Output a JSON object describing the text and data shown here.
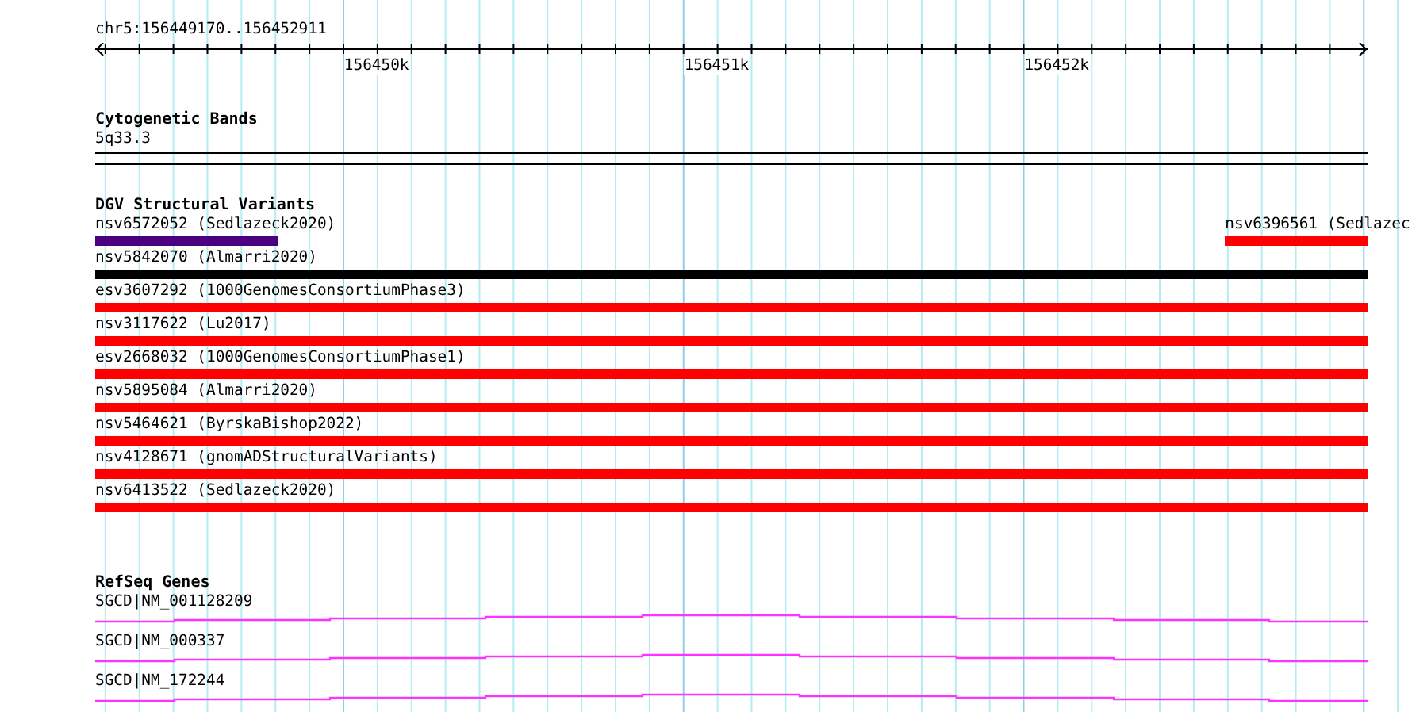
{
  "ruler": {
    "title": "chr5:156449170..156452911",
    "tick_labels": [
      "156450k",
      "156451k",
      "156452k"
    ]
  },
  "tracks": [
    {
      "kind": "band",
      "title": "Cytogenetic Bands",
      "label": "5q33.3"
    },
    {
      "kind": "variants",
      "title": "DGV Structural Variants",
      "rows": [
        [
          {
            "label": "nsv6572052 (Sedlazeck2020)",
            "color": "#4b0082",
            "kind": "start"
          },
          {
            "label": "nsv6396561 (Sedlazec",
            "color": "#ff0000",
            "kind": "end"
          }
        ],
        [
          {
            "label": "nsv5842070 (Almarri2020)",
            "color": "#000000",
            "kind": "full"
          }
        ],
        [
          {
            "label": "esv3607292 (1000GenomesConsortiumPhase3)",
            "color": "#ff0000",
            "kind": "full"
          }
        ],
        [
          {
            "label": "nsv3117622 (Lu2017)",
            "color": "#ff0000",
            "kind": "full"
          }
        ],
        [
          {
            "label": "esv2668032 (1000GenomesConsortiumPhase1)",
            "color": "#ff0000",
            "kind": "full"
          }
        ],
        [
          {
            "label": "nsv5895084 (Almarri2020)",
            "color": "#ff0000",
            "kind": "full"
          }
        ],
        [
          {
            "label": "nsv5464621 (ByrskaBishop2022)",
            "color": "#ff0000",
            "kind": "full"
          }
        ],
        [
          {
            "label": "nsv4128671 (gnomADStructuralVariants)",
            "color": "#ff0000",
            "kind": "full"
          }
        ],
        [
          {
            "label": "nsv6413522 (Sedlazeck2020)",
            "color": "#ff0000",
            "kind": "full"
          }
        ]
      ]
    },
    {
      "kind": "genes",
      "title": "RefSeq Genes",
      "transcripts": [
        {
          "label": "SGCD|NM_001128209"
        },
        {
          "label": "SGCD|NM_000337"
        },
        {
          "label": "SGCD|NM_172244"
        }
      ]
    }
  ]
}
